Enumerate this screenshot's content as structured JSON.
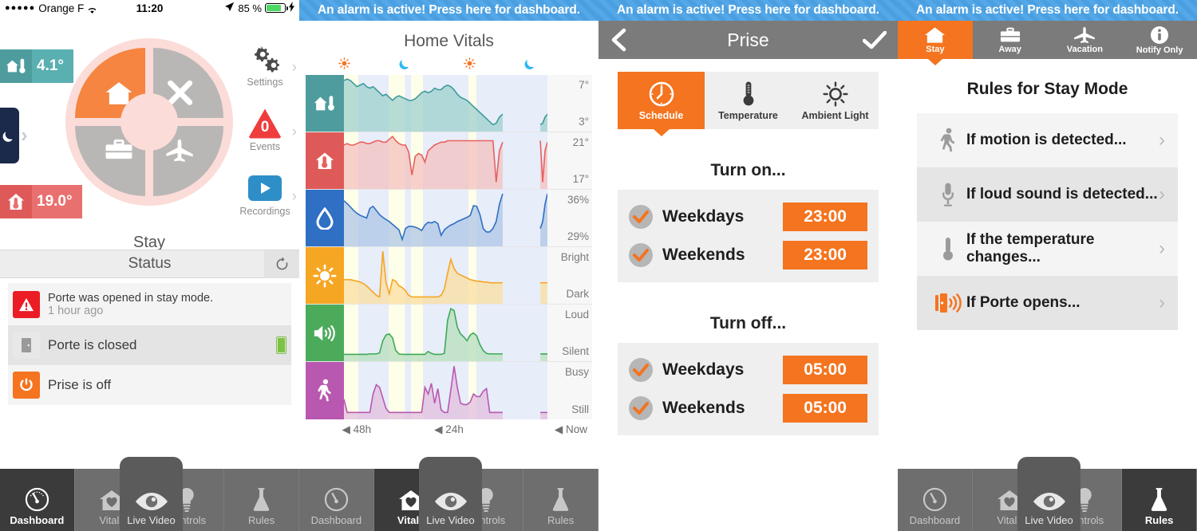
{
  "statusbar": {
    "carrier": "Orange F",
    "signal_dots": "●●●●●",
    "time": "11:20",
    "battery_text": "85 %",
    "battery_pct": 85
  },
  "alarm_banner": {
    "text": "An alarm is active! Press here for dashboard."
  },
  "panel1": {
    "outside_temp": "4.1°",
    "inside_temp": "19.0°",
    "dial": {
      "label": "Stay",
      "segments": [
        {
          "name": "stay",
          "icon": "house-icon",
          "active": true
        },
        {
          "name": "away-off",
          "icon": "x-icon",
          "active": false
        },
        {
          "name": "away",
          "icon": "briefcase-icon",
          "active": false
        },
        {
          "name": "vacation",
          "icon": "airplane-icon",
          "active": false
        }
      ]
    },
    "side_menu": [
      {
        "label": "Settings",
        "icon": "gear-icon"
      },
      {
        "label": "Events",
        "icon": "alert-triangle-icon",
        "count": "0"
      },
      {
        "label": "Recordings",
        "icon": "play-icon"
      }
    ],
    "status": {
      "header": "Status",
      "refresh_icon": "refresh-icon",
      "items": [
        {
          "icon": "alert-icon",
          "title": "Porte was opened in stay mode.",
          "subtitle": "1 hour ago",
          "color": "#ec1c24"
        },
        {
          "icon": "door-icon",
          "title": "Porte is closed",
          "battery": true,
          "color": "#b4b4b4"
        },
        {
          "icon": "power-icon",
          "title": "Prise is off",
          "color": "#f4741f"
        }
      ]
    }
  },
  "tabbar": {
    "items": [
      {
        "label": "Dashboard",
        "icon": "gauge-icon"
      },
      {
        "label": "Vitals",
        "icon": "house-heart-icon"
      },
      {
        "label": "Live Video",
        "icon": "eye-icon"
      },
      {
        "label": "Controls",
        "icon": "bulb-icon"
      },
      {
        "label": "Rules",
        "icon": "flask-icon"
      }
    ],
    "panel1_active": "Dashboard",
    "panel2_active": "Vitals",
    "panel4_active": "Rules"
  },
  "panel2": {
    "title": "Home Vitals",
    "daynight": [
      {
        "icon": "sun-icon",
        "x": 13
      },
      {
        "icon": "moon-icon",
        "x": 33
      },
      {
        "icon": "sun-icon",
        "x": 55
      },
      {
        "icon": "moon-icon",
        "x": 75
      }
    ],
    "axis": [
      "◀ 48h",
      "◀ 24h",
      "◀ Now"
    ]
  },
  "chart_data": {
    "type": "line",
    "title": "Home Vitals",
    "xlabel": "",
    "x_ticks": [
      "48h",
      "24h",
      "Now"
    ],
    "grid": false,
    "legend": "none",
    "series": [
      {
        "name": "Outside Temperature",
        "icon": "house-thermometer-icon",
        "color": "#3e9a9a",
        "fill": "#9fd0ce",
        "badge_color": "#4e9c9d",
        "ymax_label": "7°",
        "ymin_label": "3°",
        "ylim": [
          3,
          7
        ],
        "values": [
          6.3,
          6.4,
          6.3,
          6.1,
          5.9,
          6.0,
          6.1,
          5.9,
          5.8,
          5.9,
          5.7,
          5.5,
          5.3,
          5.4,
          5.2,
          5.0,
          5.2,
          5.3,
          5.2,
          5.1,
          5.0,
          5.0,
          5.1,
          5.3,
          5.5,
          5.6,
          5.5,
          5.6,
          5.8,
          5.7,
          5.7,
          5.9,
          6.0,
          5.9,
          5.7,
          5.4,
          5.2,
          5.1,
          5.0,
          4.8,
          4.6,
          4.4,
          4.2,
          4.0,
          3.8,
          3.6,
          3.4,
          3.5,
          3.9,
          4.1
        ]
      },
      {
        "name": "Inside Temperature",
        "icon": "house-thermometer-red-icon",
        "color": "#e8605e",
        "fill": "#f4c0bf",
        "badge_color": "#de5a58",
        "ymax_label": "21°",
        "ymin_label": "17°",
        "ylim": [
          17,
          21
        ],
        "values": [
          20.0,
          20.1,
          20.0,
          20.0,
          20.1,
          20.2,
          20.2,
          20.1,
          20.1,
          20.2,
          20.3,
          20.3,
          20.2,
          20.2,
          20.4,
          20.6,
          20.3,
          20.1,
          20.0,
          20.0,
          19.5,
          17.9,
          19.2,
          19.4,
          19.3,
          18.8,
          19.6,
          19.8,
          20.0,
          20.1,
          20.2,
          20.2,
          20.3,
          20.3,
          20.3,
          20.3,
          20.3,
          20.3,
          20.3,
          20.3,
          20.3,
          20.3,
          20.3,
          20.3,
          20.3,
          20.3,
          20.3,
          17.4,
          19.6,
          20.2
        ]
      },
      {
        "name": "Humidity",
        "icon": "droplet-icon",
        "color": "#2f6fc4",
        "fill": "#adc6e6",
        "badge_color": "#2f6fc4",
        "ymax_label": "36%",
        "ymin_label": "29%",
        "ylim": [
          29,
          36
        ],
        "values": [
          35.0,
          34.6,
          34.1,
          33.6,
          33.2,
          32.9,
          32.7,
          32.5,
          33.9,
          34.2,
          33.6,
          33.0,
          32.6,
          32.3,
          32.0,
          31.6,
          31.2,
          30.8,
          29.4,
          31.0,
          31.3,
          31.3,
          31.2,
          31.0,
          30.7,
          31.5,
          31.9,
          31.8,
          32.0,
          31.7,
          30.0,
          30.8,
          31.2,
          31.5,
          31.7,
          32.0,
          32.2,
          32.4,
          32.6,
          32.9,
          34.3,
          34.2,
          33.0,
          31.0,
          30.5,
          30.5,
          31.0,
          32.0,
          34.5,
          36.0
        ]
      },
      {
        "name": "Ambient Light",
        "icon": "sun-filled-icon",
        "color": "#f5a623",
        "fill": "#fbdda0",
        "badge_color": "#f5a623",
        "ymax_label": "Bright",
        "ymin_label": "Dark",
        "ylim": [
          0,
          100
        ],
        "values": [
          22,
          22,
          22,
          21,
          20,
          19,
          17,
          14,
          10,
          6,
          2,
          0,
          58,
          18,
          4,
          22,
          20,
          14,
          12,
          8,
          2,
          0,
          0,
          0,
          0,
          0,
          0,
          0,
          0,
          0,
          2,
          10,
          30,
          48,
          36,
          30,
          28,
          26,
          24,
          22,
          21,
          20,
          20,
          19,
          19,
          18,
          18,
          18,
          18,
          18
        ]
      },
      {
        "name": "Sound",
        "icon": "speaker-icon",
        "color": "#3eaa54",
        "fill": "#b7dfbe",
        "badge_color": "#4bab5a",
        "ymax_label": "Loud",
        "ymin_label": "Silent",
        "ylim": [
          0,
          100
        ],
        "values": [
          2,
          2,
          2,
          2,
          2,
          2,
          2,
          2,
          3,
          3,
          3,
          5,
          30,
          42,
          44,
          36,
          10,
          3,
          2,
          2,
          2,
          2,
          2,
          2,
          2,
          2,
          8,
          4,
          2,
          2,
          2,
          4,
          72,
          96,
          92,
          58,
          44,
          38,
          30,
          42,
          46,
          40,
          22,
          10,
          4,
          3,
          3,
          3,
          3,
          3
        ]
      },
      {
        "name": "Motion",
        "icon": "walk-icon",
        "color": "#b858b0",
        "fill": "#e2bfdf",
        "badge_color": "#b858b0",
        "ymax_label": "Busy",
        "ymin_label": "Still",
        "ylim": [
          0,
          100
        ],
        "values": [
          22,
          2,
          2,
          2,
          2,
          2,
          2,
          2,
          2,
          30,
          44,
          40,
          24,
          8,
          2,
          2,
          2,
          2,
          2,
          2,
          2,
          2,
          2,
          2,
          2,
          40,
          30,
          46,
          16,
          38,
          6,
          2,
          2,
          36,
          72,
          40,
          16,
          14,
          14,
          18,
          30,
          26,
          26,
          34,
          38,
          2,
          2,
          2,
          2,
          2
        ]
      }
    ]
  },
  "panel3": {
    "nav": {
      "back_icon": "chevron-left-icon",
      "title": "Prise",
      "done_icon": "check-icon"
    },
    "segments": [
      {
        "label": "Schedule",
        "icon": "clock-icon",
        "active": true
      },
      {
        "label": "Temperature",
        "icon": "thermometer-icon",
        "active": false
      },
      {
        "label": "Ambient Light",
        "icon": "sun-outline-icon",
        "active": false
      }
    ],
    "turn_on": {
      "title": "Turn on...",
      "rows": [
        {
          "label": "Weekdays",
          "time": "23:00",
          "checked": true
        },
        {
          "label": "Weekends",
          "time": "23:00",
          "checked": true
        }
      ]
    },
    "turn_off": {
      "title": "Turn off...",
      "rows": [
        {
          "label": "Weekdays",
          "time": "05:00",
          "checked": true
        },
        {
          "label": "Weekends",
          "time": "05:00",
          "checked": true
        }
      ]
    }
  },
  "panel4": {
    "modes": [
      {
        "label": "Stay",
        "icon": "house-icon",
        "active": true
      },
      {
        "label": "Away",
        "icon": "briefcase-icon",
        "active": false
      },
      {
        "label": "Vacation",
        "icon": "airplane-icon",
        "active": false
      },
      {
        "label": "Notify Only",
        "icon": "info-icon",
        "active": false
      }
    ],
    "title": "Rules for Stay Mode",
    "rules": [
      {
        "label": "If motion is detected...",
        "icon": "walk-icon",
        "color": "#9b9b9b"
      },
      {
        "label": "If loud sound is detected...",
        "icon": "microphone-icon",
        "color": "#9b9b9b"
      },
      {
        "label": "If the temperature changes...",
        "icon": "thermometer-icon",
        "color": "#9b9b9b"
      },
      {
        "label": "If Porte opens...",
        "icon": "door-signal-icon",
        "color": "#f4741f"
      }
    ]
  },
  "colors": {
    "accent_orange": "#f4741f",
    "alarm_blue": "#4a9fe0",
    "grey_nav": "#7b7b7b",
    "tab_dark": "#3b3b3b"
  }
}
